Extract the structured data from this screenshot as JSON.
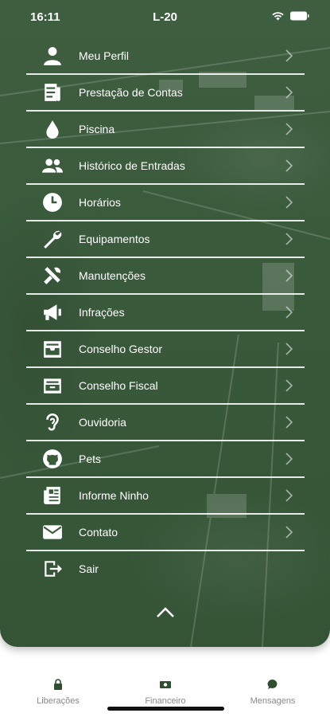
{
  "status": {
    "time": "16:11",
    "title": "L-20"
  },
  "menu": {
    "items": [
      {
        "label": "Meu Perfil",
        "icon": "person-icon"
      },
      {
        "label": "Prestação de Contas",
        "icon": "receipt-icon"
      },
      {
        "label": "Piscina",
        "icon": "water-drop-icon"
      },
      {
        "label": "Histórico de Entradas",
        "icon": "people-icon"
      },
      {
        "label": "Horários",
        "icon": "clock-icon"
      },
      {
        "label": "Equipamentos",
        "icon": "wrench-icon"
      },
      {
        "label": "Manutenções",
        "icon": "tools-icon"
      },
      {
        "label": "Infrações",
        "icon": "megaphone-icon"
      },
      {
        "label": "Conselho Gestor",
        "icon": "inbox-icon"
      },
      {
        "label": "Conselho Fiscal",
        "icon": "archive-icon"
      },
      {
        "label": "Ouvidoria",
        "icon": "ear-icon"
      },
      {
        "label": "Pets",
        "icon": "github-cat-icon"
      },
      {
        "label": "Informe Ninho",
        "icon": "newspaper-icon"
      },
      {
        "label": "Contato",
        "icon": "envelope-icon"
      },
      {
        "label": "Sair",
        "icon": "logout-icon"
      }
    ]
  },
  "tabbar": {
    "tabs": [
      {
        "label": "Liberações",
        "icon": "lock-icon"
      },
      {
        "label": "Financeiro",
        "icon": "money-icon"
      },
      {
        "label": "Mensagens",
        "icon": "chat-bubble-icon"
      }
    ]
  },
  "colors": {
    "panel": "#3a5a3c",
    "text": "#ffffff",
    "tab_text": "#8a8a8a",
    "tab_icon": "#2f4f31"
  }
}
